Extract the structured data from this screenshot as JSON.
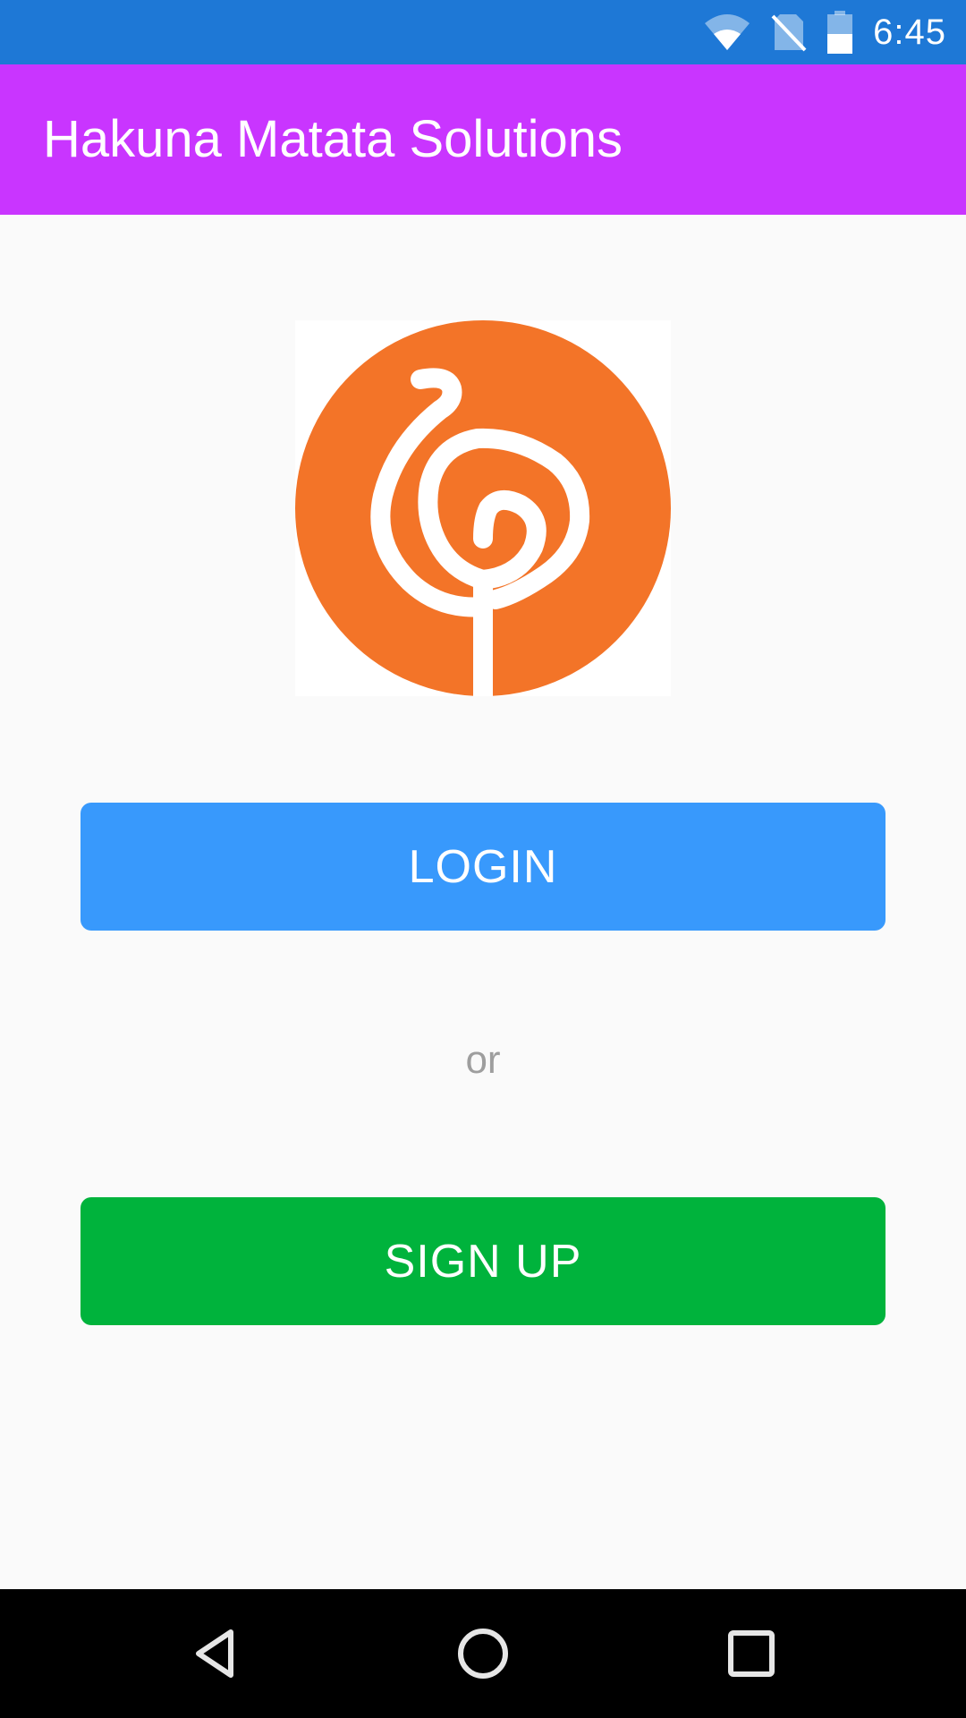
{
  "status_bar": {
    "time": "6:45",
    "icons": [
      "wifi-icon",
      "no-sim-icon",
      "battery-icon"
    ]
  },
  "app_bar": {
    "title": "Hakuna Matata Solutions"
  },
  "logo": {
    "icon": "swirl-logo-icon",
    "colors": {
      "circle": "#f37428",
      "swirl": "#ffffff"
    }
  },
  "actions": {
    "login_label": "LOGIN",
    "or_label": "or",
    "signup_label": "SIGN UP"
  },
  "nav_bar": {
    "icons": [
      "back-icon",
      "home-icon",
      "recents-icon"
    ]
  },
  "colors": {
    "status_bar": "#1e78d6",
    "app_bar": "#c935ff",
    "login_button": "#3899fc",
    "signup_button": "#00b33c",
    "background": "#fafafa"
  }
}
